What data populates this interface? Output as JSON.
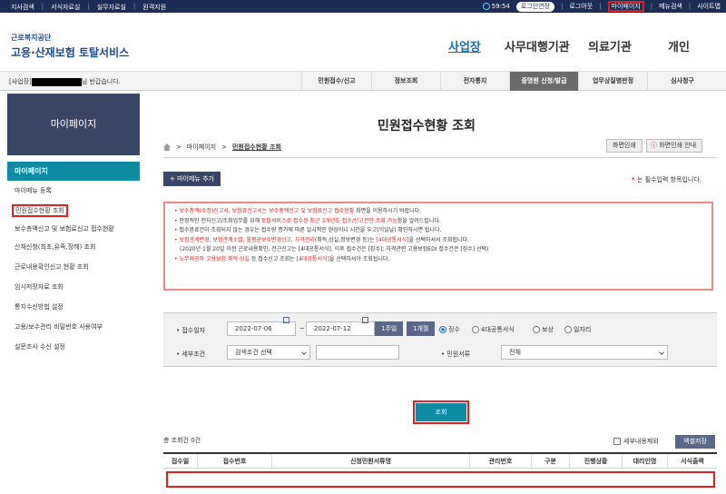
{
  "topbar": {
    "left": [
      "지사검색",
      "서식자료실",
      "실무자료실",
      "원격지원"
    ],
    "count": "59:54",
    "login_extend": "로그인연장",
    "right": [
      "로그아웃",
      "마이페이지",
      "메뉴검색",
      "사이트맵"
    ]
  },
  "logo": {
    "org": "근로복지공단",
    "service": "고용·산재보험 토탈서비스"
  },
  "mainnav": [
    "사업장",
    "사무대행기관",
    "의료기관",
    "개인"
  ],
  "welcome": {
    "prefix": "[사업장]",
    "suffix": "님 반갑습니다."
  },
  "subnav": [
    "민원접수/신고",
    "정보조회",
    "전자통지",
    "증명원 신청/발급",
    "업무상질병판정",
    "심사청구"
  ],
  "sidebar": {
    "head": "마이페이지",
    "title": "마이페이지",
    "items": [
      "마이메뉴 등록",
      "민원접수현황 조회",
      "보수총액신고 및 보험료신고 접수현황",
      "산재신청(최초,유족,장해) 조회",
      "근로내용확인신고 현황 조회",
      "임시저장자료 조회",
      "통지수신방법 설정",
      "고용/보수관리 비밀번호 사용여부",
      "설문조사 수신 설정"
    ]
  },
  "page": {
    "title": "민원접수현황 조회",
    "breadcrumb": [
      "마이페이지",
      "민원접수현황 조회"
    ],
    "print_btn": "화면인쇄",
    "print_guide_btn": "화면인쇄 안내",
    "add_menu_btn": "+ 마이메뉴 추가",
    "required_mark": "*",
    "required_text": "는 필수입력 항목입니다."
  },
  "notices": [
    {
      "parts": [
        {
          "t": "보수총액(수정)신고서, 보험료신고서는 보수총액신고 및 보험료신고 접수현황",
          "red": true
        },
        {
          "t": " 화면을 이용하시기 바랍니다.",
          "red": false
        }
      ]
    },
    {
      "parts": [
        {
          "t": "안정적인 전자신고/조회업무를 위해 ",
          "red": false
        },
        {
          "t": "토탈서비스로 접수된 최근 3개년도 접수/신고건만 조회 가능",
          "red": true
        },
        {
          "t": "함을 알려드립니다.",
          "red": false
        }
      ]
    },
    {
      "parts": [
        {
          "t": "접수완료건이 조회되지 않는 경우는 접수량 증가에 따른 일시적인 현상이니 시간을 두고(익일날) 확인하시면 됩니다.",
          "red": false
        }
      ]
    },
    {
      "parts": [
        {
          "t": "보험관계변경, 보험관계소멸, 월평균보수변경신고, 자격관리",
          "red": true
        },
        {
          "t": "(취득,상실,정보변경 등)는 ",
          "red": false
        },
        {
          "t": "[4대공통서식]",
          "red": true
        },
        {
          "t": "을 선택하셔서 조회됩니다.",
          "red": false
        }
      ]
    },
    {
      "parts": [
        {
          "t": "(2020년 1월 20일 이전 근로내용확인, 전근신고는 [4대공통서식], 이후 접수건은 [징수]; 자격관련 고용보험EDI 접수건은 [징수] 선택)",
          "red": false
        }
      ],
      "indent": true
    },
    {
      "parts": [
        {
          "t": "노무제공자 고용보험 취득·상실",
          "red": true
        },
        {
          "t": " 등 접수신고 조회는 ",
          "red": false
        },
        {
          "t": "[4대공통서식]",
          "red": true
        },
        {
          "t": "을 선택하셔야 조회됩니다.",
          "red": false
        }
      ]
    }
  ],
  "form": {
    "date_label": "접수일자",
    "date_from": "2022-07-06",
    "date_sep": "~",
    "date_to": "2022-07-12",
    "btn_1w": "1주일",
    "btn_1m": "1개월",
    "radios": [
      {
        "label": "징수",
        "checked": true
      },
      {
        "label": "4대공통서식",
        "checked": false
      },
      {
        "label": "보상",
        "checked": false
      },
      {
        "label": "일자리",
        "checked": false
      }
    ],
    "detail_label": "세부조건",
    "detail_select": "검색조건 선택",
    "detail_input": "",
    "type_label": "민원서류",
    "type_select": "전체",
    "search_btn": "조회"
  },
  "results": {
    "total": "총 조회건 0건",
    "exclude_detail": "세부내용제외",
    "excel": "엑셀저장",
    "columns": [
      "접수일",
      "접수번호",
      "신청민원서류명",
      "관리번호",
      "구분",
      "진행상황",
      "대리인명",
      "서식출력"
    ]
  }
}
